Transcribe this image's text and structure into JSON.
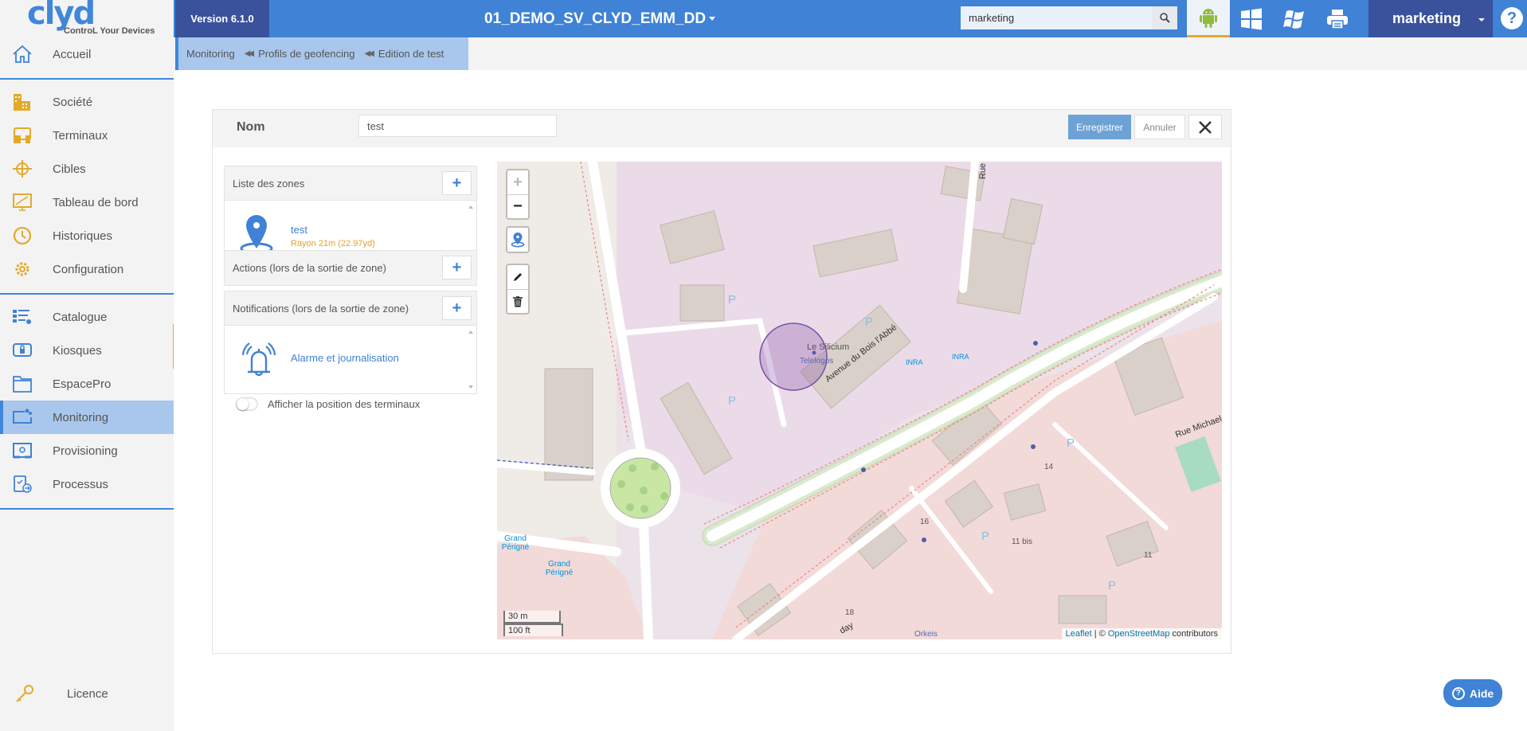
{
  "logo": {
    "brand": "clyd",
    "tagline": "ControL Your Devices"
  },
  "sidebar": {
    "items": [
      {
        "label": "Accueil",
        "icon": "home-icon"
      },
      {
        "label": "Société",
        "icon": "buildings-icon"
      },
      {
        "label": "Terminaux",
        "icon": "devices-icon"
      },
      {
        "label": "Cibles",
        "icon": "target-icon"
      },
      {
        "label": "Tableau de bord",
        "icon": "dashboard-icon"
      },
      {
        "label": "Historiques",
        "icon": "history-icon"
      },
      {
        "label": "Configuration",
        "icon": "gear-icon"
      },
      {
        "label": "Catalogue",
        "icon": "catalog-icon"
      },
      {
        "label": "Kiosques",
        "icon": "kiosk-lock-icon"
      },
      {
        "label": "EspacePro",
        "icon": "folder-icon"
      },
      {
        "label": "Monitoring",
        "icon": "monitoring-icon",
        "active": true
      },
      {
        "label": "Provisioning",
        "icon": "provisioning-icon"
      },
      {
        "label": "Processus",
        "icon": "process-icon"
      }
    ],
    "footer": {
      "label": "Licence",
      "icon": "key-icon"
    }
  },
  "topbar": {
    "version": "Version 6.1.0",
    "tenant": "01_DEMO_SV_CLYD_EMM_DD",
    "search_value": "marketing",
    "os_tabs": [
      "android-icon",
      "windows-icon",
      "windows-legacy-icon",
      "printer-icon"
    ],
    "active_os": "android",
    "user": "marketing",
    "help": "?"
  },
  "breadcrumb": [
    "Monitoring",
    "Profils de geofencing",
    "Edition de test"
  ],
  "form": {
    "name_label": "Nom",
    "name_value": "test",
    "save_label": "Enregistrer",
    "cancel_label": "Annuler"
  },
  "zones_panel": {
    "title": "Liste des zones",
    "zones": [
      {
        "name": "test",
        "radius": "Rayon 21m (22.97yd)"
      }
    ]
  },
  "actions_panel": {
    "title": "Actions (lors de la sortie de zone)"
  },
  "notifications_panel": {
    "title": "Notifications (lors de la sortie de zone)",
    "items": [
      {
        "name": "Alarme et journalisation"
      }
    ]
  },
  "toggle": {
    "label": "Afficher la position des terminaux",
    "on": false
  },
  "map": {
    "labels": {
      "poi_name": "Le Silicium",
      "poi_company": "Telelogos",
      "street_main": "Avenue du Bois l'Abbé",
      "street_2": "Rue Michael",
      "street_3": "Rue F",
      "street_4": "day",
      "bus_1": "INRA",
      "bus_2": "INRA",
      "bus_3": "Grand Périgné",
      "bus_4": "Grand Périgné",
      "num_14": "14",
      "num_16": "16",
      "num_11bis": "11 bis",
      "num_11": "11",
      "num_18": "18",
      "orkeis": "Orkeis",
      "parking": "P"
    },
    "scale_metric": "30 m",
    "scale_imperial": "100 ft",
    "attribution_leaflet": "Leaflet",
    "attribution_sep": " | © ",
    "attribution_osm": "OpenStreetMap",
    "attribution_tail": " contributors",
    "zone_radius_m": 21
  },
  "aide_label": "Aide"
}
